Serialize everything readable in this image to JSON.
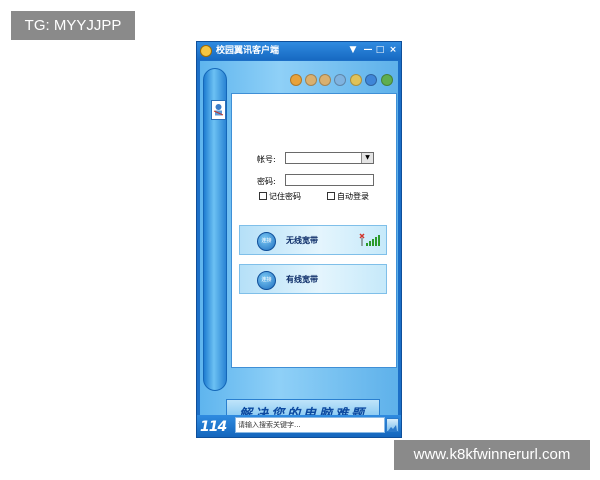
{
  "watermarks": {
    "top_left": "TG: MYYJJPP",
    "bottom_right": "www.k8kfwinnerurl.com"
  },
  "window": {
    "title": "校园翼讯客户端",
    "controls": {
      "menu": "▼",
      "minimize": "—",
      "maximize": "□",
      "close": "×"
    }
  },
  "toolbar": {
    "icons": [
      {
        "name": "tool-icon-1",
        "color": "#e8a23a"
      },
      {
        "name": "tool-icon-2",
        "color": "#d9b070"
      },
      {
        "name": "tool-icon-3",
        "color": "#d9b070"
      },
      {
        "name": "tool-icon-4",
        "color": "#7fb3e0"
      },
      {
        "name": "tool-icon-5",
        "color": "#e0c25a"
      },
      {
        "name": "tool-icon-6",
        "color": "#3f86d8"
      },
      {
        "name": "tool-icon-7",
        "color": "#5fae4e"
      }
    ]
  },
  "login": {
    "account_label": "帐号:",
    "account_value": "",
    "password_label": "密码:",
    "password_value": "",
    "remember_label": "记住密码",
    "auto_login_label": "自动登录",
    "remember_checked": false,
    "auto_login_checked": false
  },
  "connections": [
    {
      "badge": "连接",
      "label": "无线宽带"
    },
    {
      "badge": "连接",
      "label": "有线宽带"
    }
  ],
  "banner": {
    "text": "解决您的电脑难题"
  },
  "search": {
    "logo": "114",
    "placeholder": "请输入搜索关键字..."
  },
  "colors": {
    "window_blue": "#1c6fc7",
    "panel_bg": "#ffffff",
    "banner_text": "#0d4aa0"
  }
}
